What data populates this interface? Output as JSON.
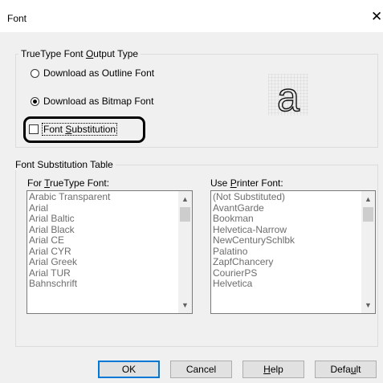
{
  "dialog": {
    "title": "Font",
    "close_glyph": "✕"
  },
  "output_group": {
    "title_pre": "TrueType Font ",
    "title_u": "O",
    "title_post": "utput Type",
    "options": [
      {
        "label": "Download as Outline Font",
        "checked": false
      },
      {
        "label": "Download as Bitmap Font",
        "checked": true
      }
    ],
    "font_substitution": {
      "label_pre": "Font ",
      "label_u": "S",
      "label_post": "ubstitution",
      "checked": false
    },
    "preview_glyph": "a"
  },
  "substitution_group": {
    "title": "Font Substitution Table",
    "truetype": {
      "label_pre": "For ",
      "label_u": "T",
      "label_post": "rueType Font:",
      "items": [
        "Arabic Transparent",
        "Arial",
        "Arial Baltic",
        "Arial Black",
        "Arial CE",
        "Arial CYR",
        "Arial Greek",
        "Arial TUR",
        "Bahnschrift"
      ]
    },
    "printer": {
      "label_pre": "Use ",
      "label_u": "P",
      "label_post": "rinter Font:",
      "items": [
        "(Not Substituted)",
        "AvantGarde",
        "Bookman",
        "Helvetica-Narrow",
        "NewCenturySchlbk",
        "Palatino",
        "ZapfChancery",
        "CourierPS",
        "Helvetica"
      ]
    }
  },
  "buttons": {
    "ok": "OK",
    "cancel": "Cancel",
    "help_u": "H",
    "help_post": "elp",
    "default_pre": "Defa",
    "default_u": "u",
    "default_post": "lt"
  },
  "colors": {
    "focus_blue": "#0078d7",
    "dialog_bg": "#f0f0f0",
    "disabled_text": "#6d6d6d"
  }
}
